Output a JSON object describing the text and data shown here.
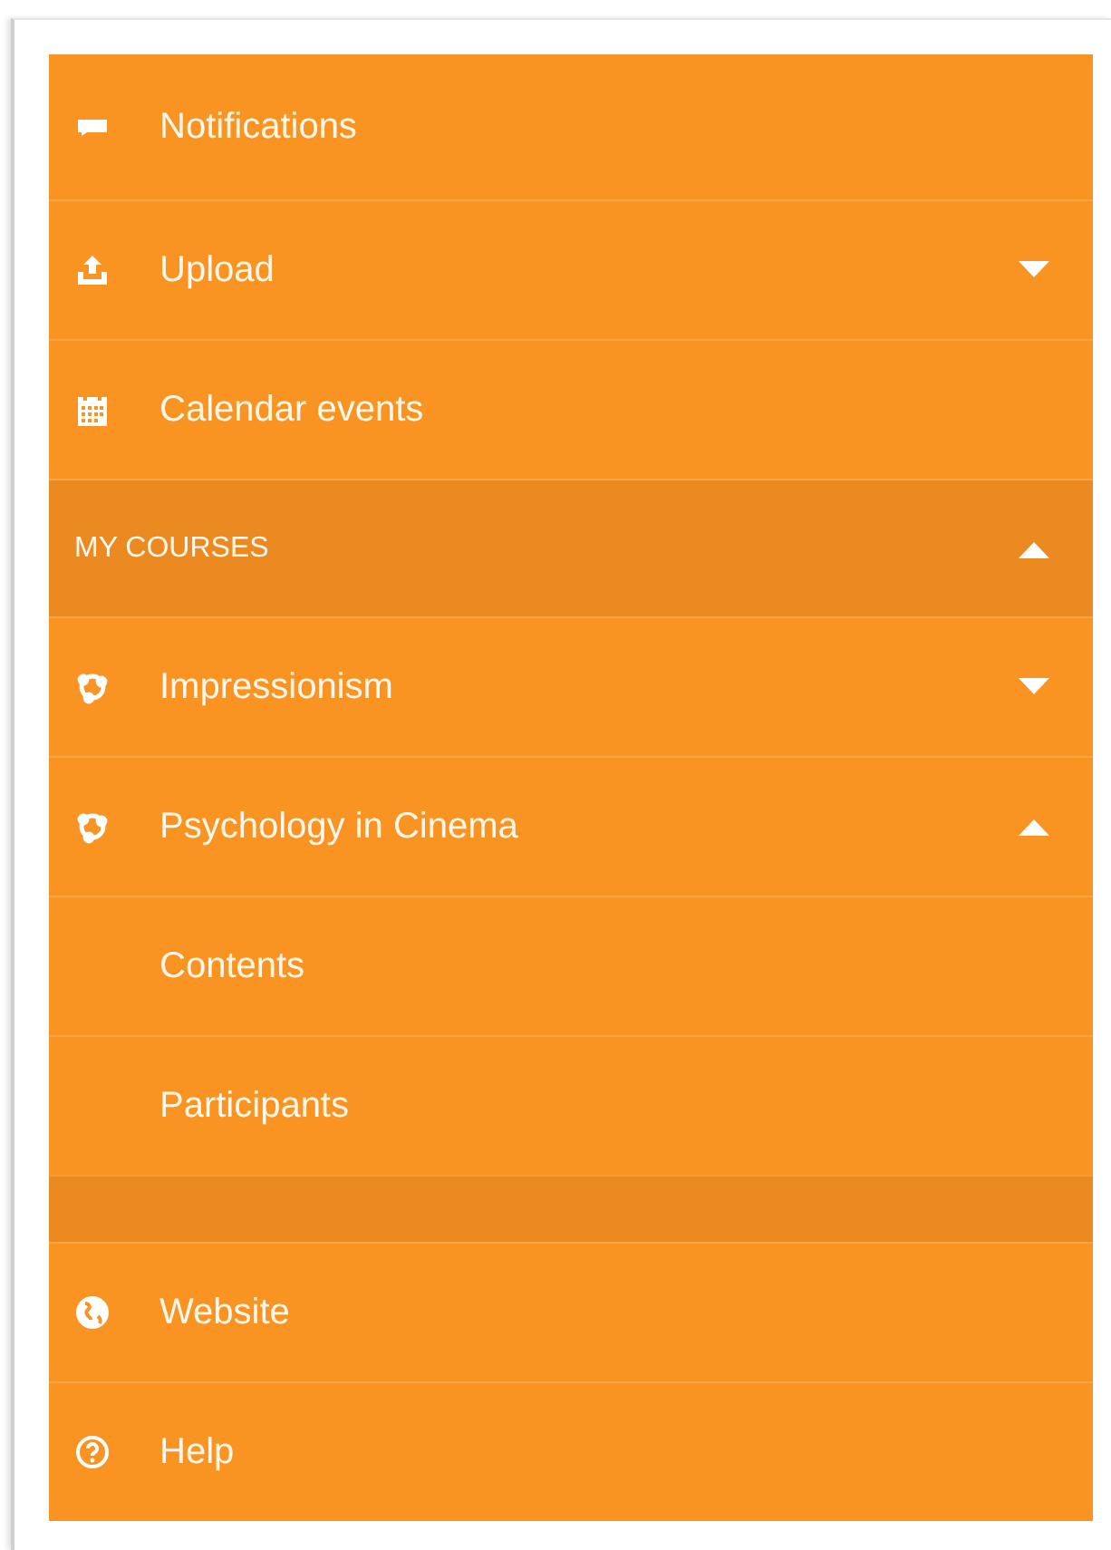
{
  "menu": [
    {
      "kind": "item",
      "label": "Notifications"
    },
    {
      "kind": "item",
      "label": "Upload",
      "expanded": false
    },
    {
      "kind": "item",
      "label": "Calendar events"
    },
    {
      "kind": "section",
      "label": "MY COURSES",
      "expanded": true,
      "children": [
        {
          "label": "Impressionism",
          "expanded": false
        },
        {
          "label": "Psychology in Cinema",
          "expanded": true,
          "children": [
            {
              "label": "Contents"
            },
            {
              "label": "Participants"
            }
          ]
        }
      ]
    },
    {
      "kind": "item",
      "label": "Website"
    },
    {
      "kind": "item",
      "label": "Help"
    }
  ]
}
